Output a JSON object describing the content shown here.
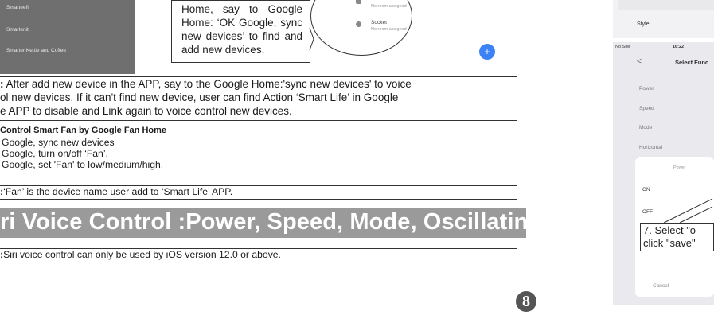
{
  "left_list": {
    "items": [
      "Smarteefi",
      "Smartenit",
      "Smarter Kettle and Coffee"
    ]
  },
  "callout": {
    "text": "Home, say to Google Home: ‘OK Google, sync new devices’ to find and add new devices."
  },
  "bubble": {
    "device1_sub": "No room assigned",
    "device2_label": "Socket",
    "device2_sub": "No room assigned"
  },
  "fab": {
    "symbol": "+"
  },
  "note1": {
    "line1_prefix": ":",
    "line1": " After add new device in the APP, say to the Google Home:'sync new devices' to voice",
    "line2": "ol new devices. If it can't find new device, user can find Action ‘Smart Life’ in Google",
    "line3": "e APP to disable and Link again to voice control new devices."
  },
  "fan_section": {
    "heading": "Control Smart Fan by Google Fan Home",
    "cmd1": "Google, sync new devices",
    "cmd2": "Google, turn on/off ‘Fan’.",
    "cmd3": "Google, set 'Fan' to low/medium/high."
  },
  "note2": {
    "prefix": ":",
    "text": "‘Fan’ is the device name user add to ‘Smart Life’ APP."
  },
  "siri": {
    "title": "ri Voice Control :Power, Speed, Mode, Oscillating"
  },
  "note3": {
    "prefix": ":",
    "text": "Siri voice control can only be used by iOS version 12.0 or above."
  },
  "page_number": "8",
  "right_top": {
    "style_label": "Style"
  },
  "right_phone": {
    "carrier": "No SIM",
    "time": "16:22",
    "back": "<",
    "title": "Select Func",
    "functions": [
      "Power",
      "Speed",
      "Mode",
      "Horizontal"
    ],
    "sheet_title": "Power",
    "options": [
      "ON",
      "OFF"
    ],
    "cancel": "Cancel",
    "step_line1": "7. Select \"o",
    "step_line2": "click \"save\""
  }
}
